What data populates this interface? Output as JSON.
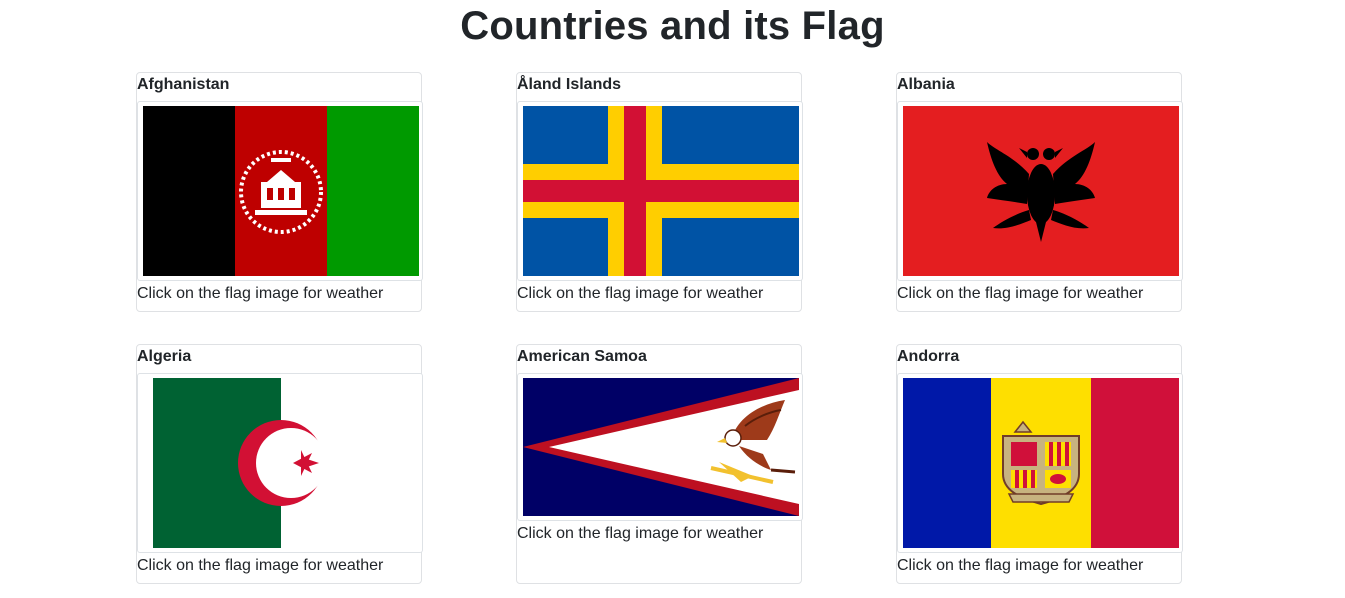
{
  "page": {
    "title": "Countries and its Flag"
  },
  "cards": [
    {
      "country": "Afghanistan",
      "caption": "Click on the flag image for weather",
      "flag_icon": "afghanistan-flag",
      "colors": [
        "#000000",
        "#be0000",
        "#009a00"
      ]
    },
    {
      "country": "Åland Islands",
      "caption": "Click on the flag image for weather",
      "flag_icon": "aland-islands-flag",
      "colors": [
        "#0053a5",
        "#ffce00",
        "#d21034"
      ]
    },
    {
      "country": "Albania",
      "caption": "Click on the flag image for weather",
      "flag_icon": "albania-flag",
      "colors": [
        "#e41e20",
        "#000000"
      ]
    },
    {
      "country": "Algeria",
      "caption": "Click on the flag image for weather",
      "flag_icon": "algeria-flag",
      "colors": [
        "#006233",
        "#ffffff",
        "#d21034"
      ]
    },
    {
      "country": "American Samoa",
      "caption": "Click on the flag image for weather",
      "flag_icon": "american-samoa-flag",
      "colors": [
        "#000066",
        "#bd1021",
        "#ffffff"
      ]
    },
    {
      "country": "Andorra",
      "caption": "Click on the flag image for weather",
      "flag_icon": "andorra-flag",
      "colors": [
        "#0018a8",
        "#fedf00",
        "#d0103a"
      ]
    }
  ]
}
